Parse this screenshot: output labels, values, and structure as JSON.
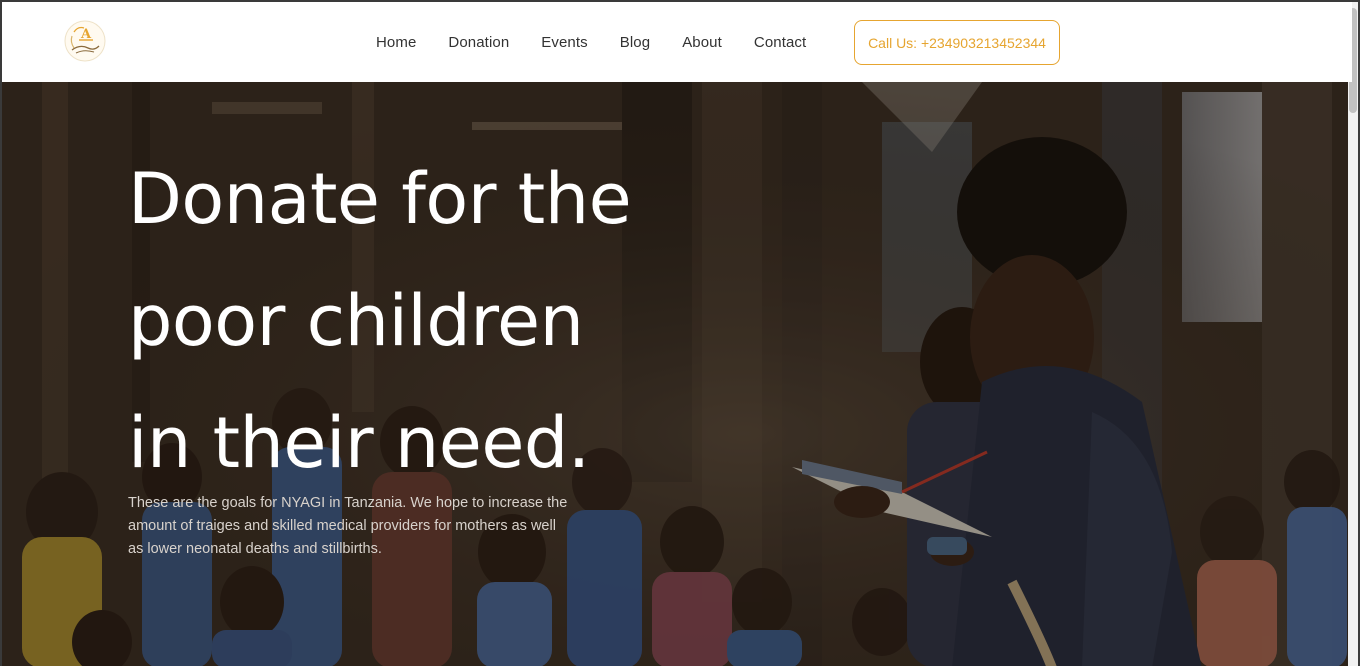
{
  "header": {
    "nav": [
      {
        "label": "Home"
      },
      {
        "label": "Donation"
      },
      {
        "label": "Events"
      },
      {
        "label": "Blog"
      },
      {
        "label": "About"
      },
      {
        "label": "Contact"
      }
    ],
    "call_button": "Call Us: +234903213452344"
  },
  "hero": {
    "title_lines": [
      "Donate for the",
      "poor children",
      "in their need."
    ],
    "description": "These are the goals for NYAGI in Tanzania. We hope to increase the amount of traiges and skilled medical providers for mothers as well as lower neonatal deaths and stillbirths."
  },
  "colors": {
    "accent": "#e6a530",
    "header_bg": "#ffffff",
    "nav_text": "#333333",
    "hero_text": "#ffffff"
  },
  "icons": {
    "logo": "organization-logo"
  }
}
